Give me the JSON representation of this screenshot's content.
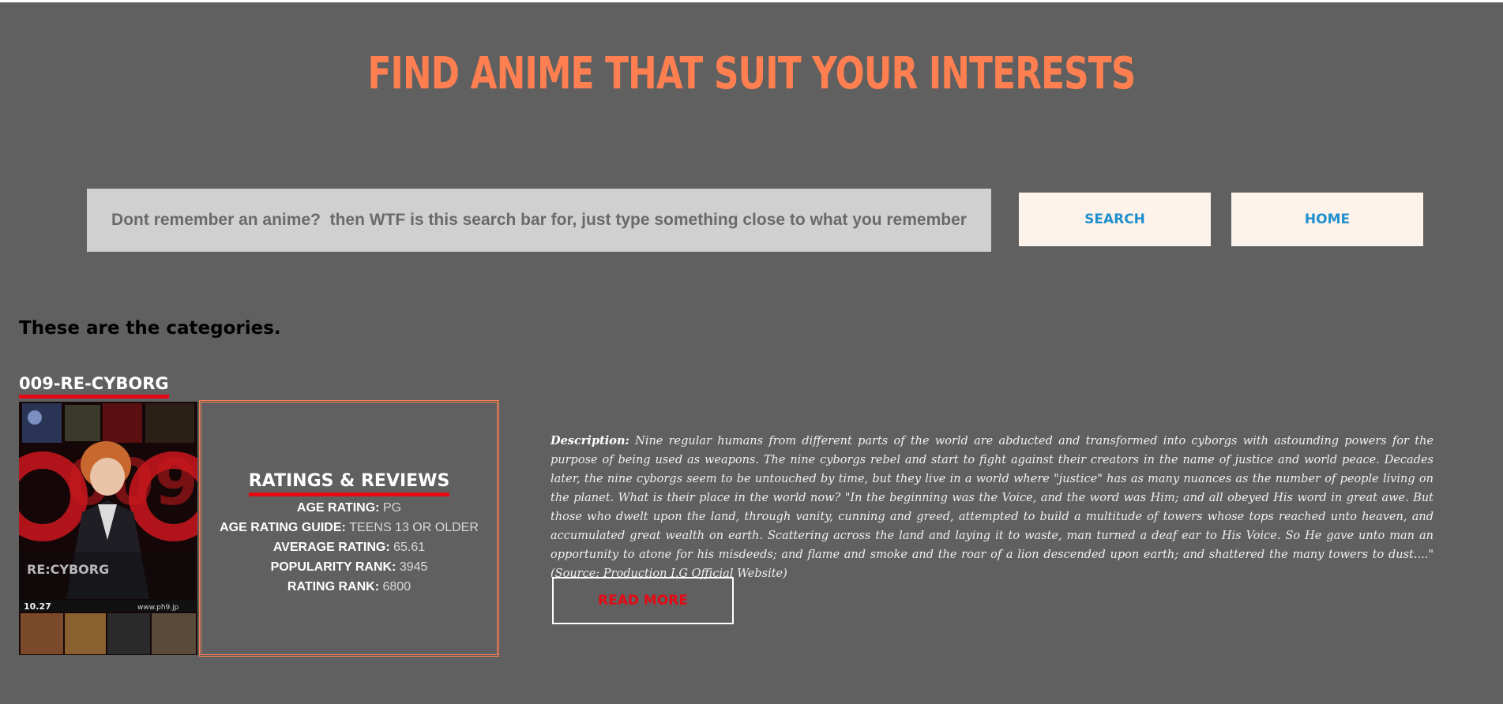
{
  "header": {
    "title": "FIND ANIME THAT SUIT YOUR INTERESTS"
  },
  "search": {
    "placeholder": "Dont remember an anime?  then WTF is this search bar for, just type something close to what you remember",
    "search_label": "SEARCH",
    "home_label": "HOME"
  },
  "section": {
    "heading": "These are the categories."
  },
  "anime": {
    "name": "009-RE-CYBORG",
    "poster_texts": {
      "big_title": "009",
      "subtitle": "RE:CYBORG",
      "date": "10.27",
      "url": "www.ph9.jp"
    },
    "ratings": {
      "title": "RATINGS & REVIEWS",
      "lines": [
        {
          "label": "AGE RATING:",
          "value": "PG"
        },
        {
          "label": "AGE RATING GUIDE:",
          "value": "TEENS 13 OR OLDER"
        },
        {
          "label": "AVERAGE RATING:",
          "value": "65.61"
        },
        {
          "label": "POPULARITY RANK:",
          "value": "3945"
        },
        {
          "label": "RATING RANK:",
          "value": "6800"
        }
      ]
    },
    "description_label": "Description:",
    "description": "Nine regular humans from different parts of the world are abducted and transformed into cyborgs with astounding powers for the purpose of being used as weapons. The nine cyborgs rebel and start to fight against their creators in the name of justice and world peace. Decades later, the nine cyborgs seem to be untouched by time, but they live in a world where \"justice\" has as many nuances as the number of people living on the planet. What is their place in the world now? \"In the beginning was the Voice, and the word was Him; and all obeyed His word in great awe. But those who dwelt upon the land, through vanity, cunning and greed, attempted to build a multitude of towers whose tops reached unto heaven, and accumulated great wealth on earth. Scattering across the land and laying it to waste, man turned a deaf ear to His Voice. So He gave unto man an opportunity to atone for his misdeeds; and flame and smoke and the roar of a lion descended upon earth; and shattered the many towers to dust....\" (Source: Production I.G Official Website)",
    "read_more_label": "READ MORE"
  },
  "colors": {
    "background": "#606060",
    "title": "#ff7f50",
    "button_text": "#1f8fce",
    "accent_red": "#e50914"
  }
}
